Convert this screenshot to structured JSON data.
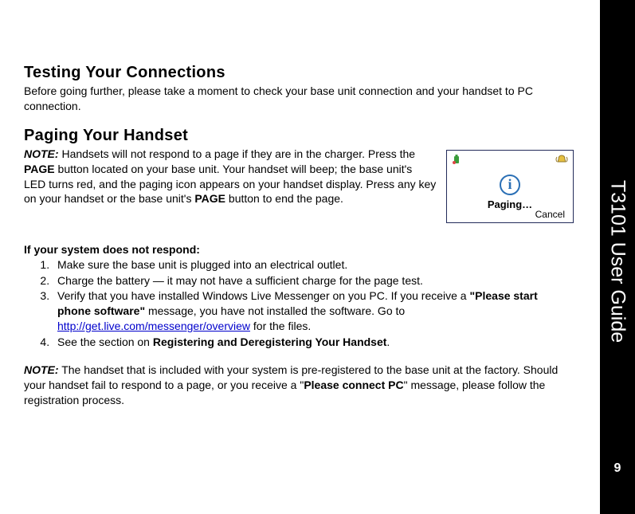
{
  "sidebar": {
    "title": "T3101 User Guide",
    "page_number": "9"
  },
  "s1": {
    "heading": "Testing Your Connections",
    "body": "Before going further, please take a moment to check your base unit connection and your handset to PC connection."
  },
  "s2": {
    "heading": "Paging Your Handset",
    "note_label": "NOTE:",
    "p1a": " Handsets will not respond to a page if they are in the charger. Press the ",
    "p1b": "PAGE",
    "p1c": " button located on your base unit. Your handset will beep; the base unit's LED turns red, and the paging icon appears on your handset display. Press any key on your handset or the base unit's ",
    "p1d": "PAGE",
    "p1e": " button to end the page."
  },
  "screen": {
    "status": "Paging…",
    "cancel": "Cancel"
  },
  "trouble": {
    "heading": "If your system does not respond:",
    "items": {
      "i1": "Make sure the base unit is plugged into an electrical outlet.",
      "i2": "Charge the battery — it may not have a sufficient charge for the page test.",
      "i3a": "Verify that you have installed Windows Live Messenger on you PC. If you receive a ",
      "i3b": "\"Please start phone software\"",
      "i3c": " message, you have not installed the software. Go to ",
      "i3link": "http://get.live.com/messenger/overview",
      "i3d": " for the files.",
      "i4a": "See the section on ",
      "i4b": "Registering and Deregistering Your Handset",
      "i4c": "."
    }
  },
  "note2": {
    "label": "NOTE:",
    "a": " The handset that is included with your system is pre-registered to the base unit at the factory. Should your handset fail to respond to a page, or you receive a \"",
    "b": "Please connect PC",
    "c": "\" message, please follow the registration process."
  }
}
